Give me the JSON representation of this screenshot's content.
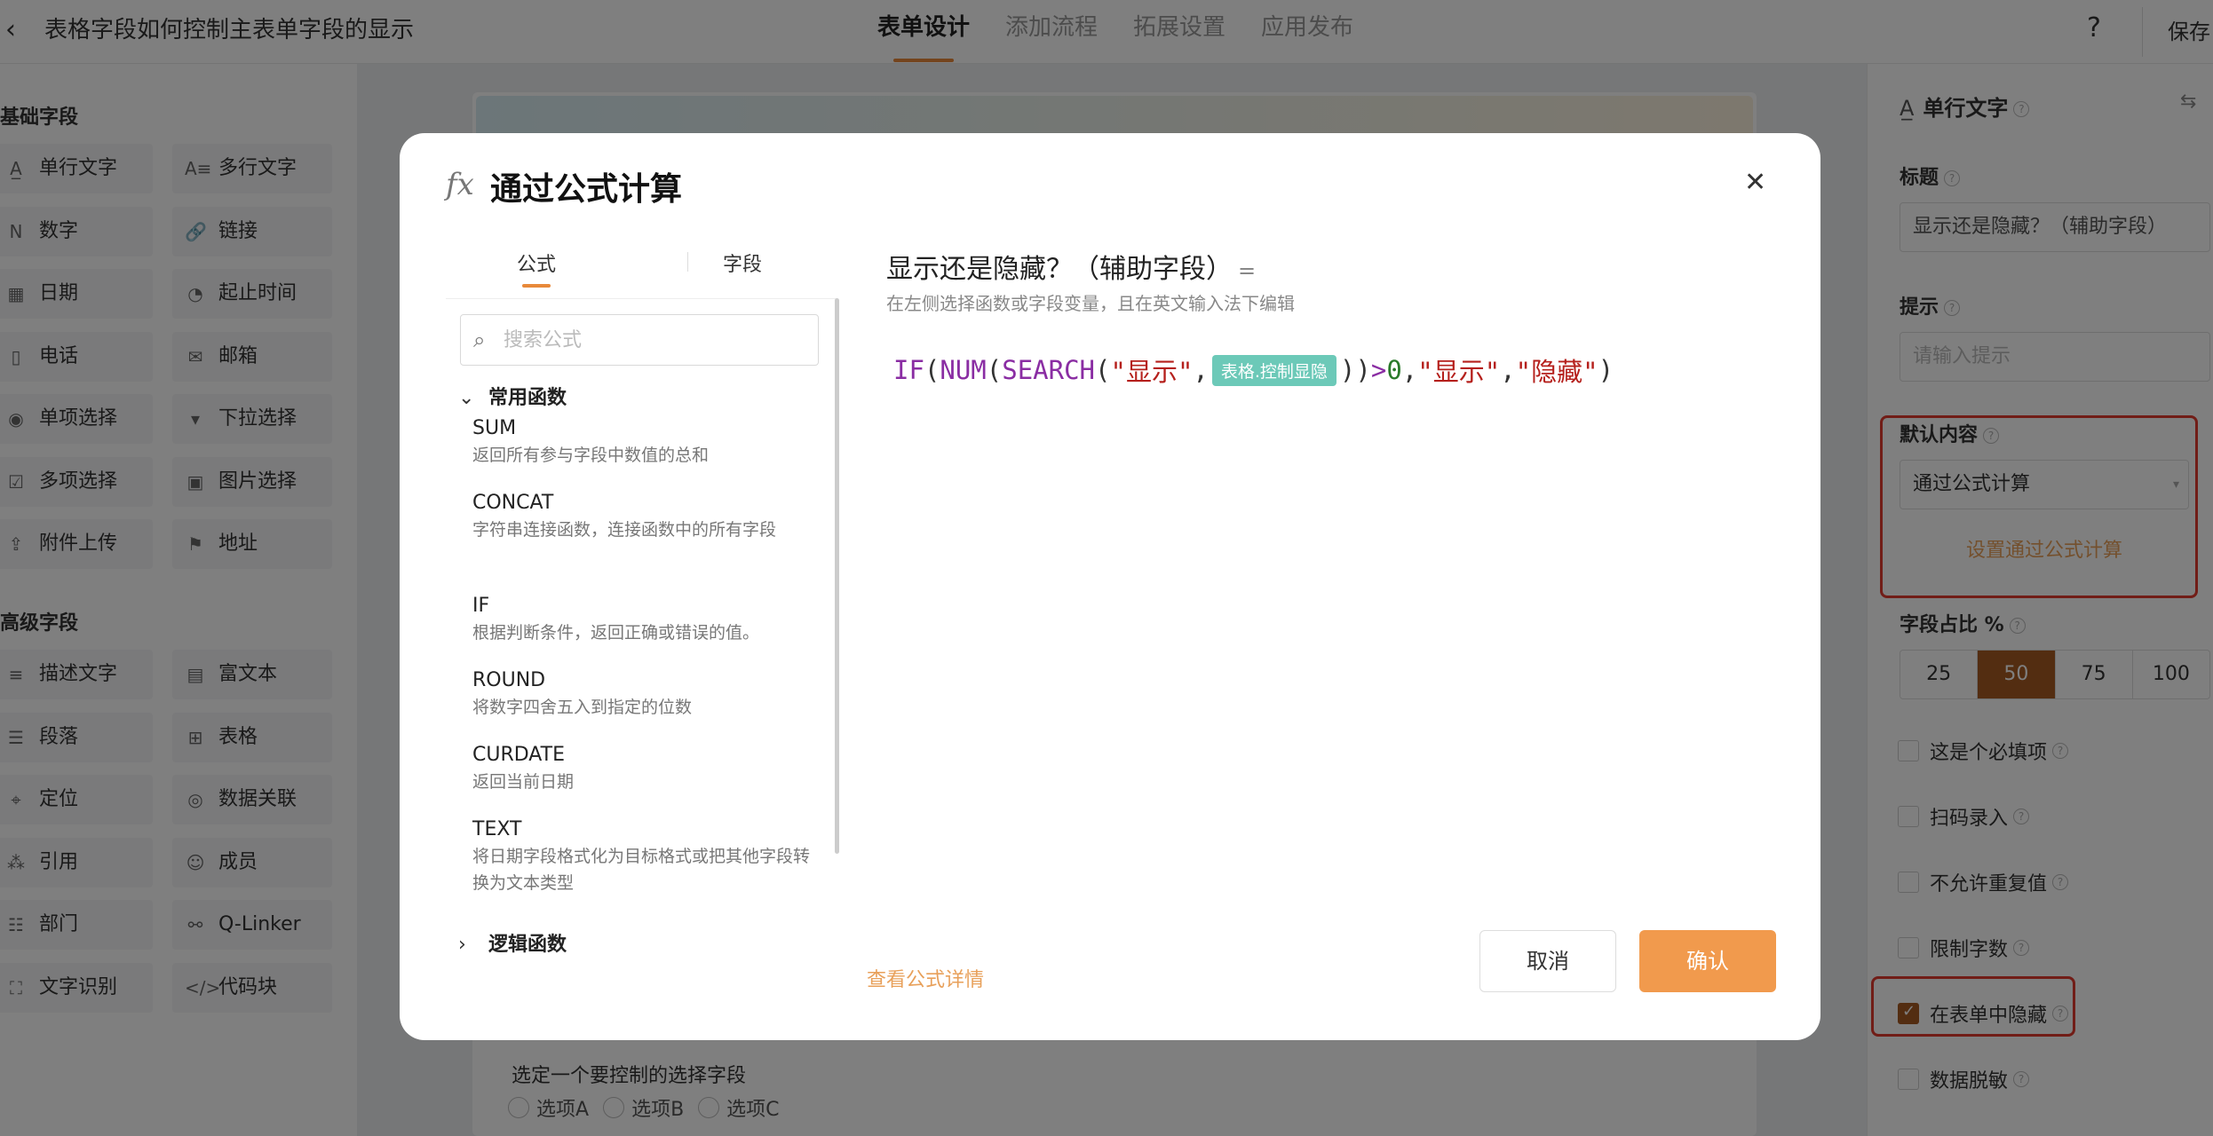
{
  "header": {
    "back_icon": "chevron-left-icon",
    "title": "表格字段如何控制主表单字段的显示",
    "tabs": [
      {
        "label": "表单设计",
        "active": true
      },
      {
        "label": "添加流程"
      },
      {
        "label": "拓展设置"
      },
      {
        "label": "应用发布"
      }
    ],
    "help_label": "?",
    "save_label": "保存"
  },
  "palette": {
    "basic_title": "基础字段",
    "basic_items": [
      {
        "label": "单行文字",
        "icon": "A̲"
      },
      {
        "label": "多行文字",
        "icon": "A≡"
      },
      {
        "label": "数字",
        "icon": "N"
      },
      {
        "label": "链接",
        "icon": "🔗"
      },
      {
        "label": "日期",
        "icon": "▦"
      },
      {
        "label": "起止时间",
        "icon": "◔"
      },
      {
        "label": "电话",
        "icon": "▯"
      },
      {
        "label": "邮箱",
        "icon": "✉"
      },
      {
        "label": "单项选择",
        "icon": "◉"
      },
      {
        "label": "下拉选择",
        "icon": "▾"
      },
      {
        "label": "多项选择",
        "icon": "☑"
      },
      {
        "label": "图片选择",
        "icon": "▣"
      },
      {
        "label": "附件上传",
        "icon": "⇪"
      },
      {
        "label": "地址",
        "icon": "⚑"
      }
    ],
    "advanced_title": "高级字段",
    "advanced_items": [
      {
        "label": "描述文字",
        "icon": "≡"
      },
      {
        "label": "富文本",
        "icon": "▤"
      },
      {
        "label": "段落",
        "icon": "☰"
      },
      {
        "label": "表格",
        "icon": "⊞"
      },
      {
        "label": "定位",
        "icon": "⌖"
      },
      {
        "label": "数据关联",
        "icon": "◎"
      },
      {
        "label": "引用",
        "icon": "⁂"
      },
      {
        "label": "成员",
        "icon": "☺"
      },
      {
        "label": "部门",
        "icon": "☷"
      },
      {
        "label": "Q-Linker",
        "icon": "⚯"
      },
      {
        "label": "文字识别",
        "icon": "⛶"
      },
      {
        "label": "代码块",
        "icon": "</>"
      }
    ]
  },
  "canvas": {
    "question": "选定一个要控制的选择字段",
    "options": [
      "选项A",
      "选项B",
      "选项C"
    ]
  },
  "right_panel": {
    "field_type": "单行文字",
    "title_label": "标题",
    "title_value": "显示还是隐藏？（辅助字段）",
    "hint_label": "提示",
    "hint_placeholder": "请输入提示",
    "default_label": "默认内容",
    "default_value": "通过公式计算",
    "default_link": "设置通过公式计算",
    "ratio_label": "字段占比 %",
    "ratios": [
      {
        "label": "25"
      },
      {
        "label": "50",
        "active": true
      },
      {
        "label": "75"
      },
      {
        "label": "100"
      }
    ],
    "checkboxes": [
      {
        "label": "这是个必填项",
        "checked": false
      },
      {
        "label": "扫码录入",
        "checked": false
      },
      {
        "label": "不允许重复值",
        "checked": false
      },
      {
        "label": "限制字数",
        "checked": false
      },
      {
        "label": "在表单中隐藏",
        "checked": true
      },
      {
        "label": "数据脱敏",
        "checked": false
      }
    ],
    "highlight_color": "#e33b2e",
    "accent_color": "#a65a22"
  },
  "modal": {
    "fx_icon": "fx",
    "title": "通过公式计算",
    "close_icon": "close-icon",
    "tabs": [
      {
        "label": "公式",
        "active": true
      },
      {
        "label": "字段"
      }
    ],
    "search_placeholder": "搜索公式",
    "groups": [
      {
        "label": "常用函数",
        "expanded": true
      },
      {
        "label": "逻辑函数",
        "expanded": false
      }
    ],
    "functions": [
      {
        "name": "SUM",
        "desc": "返回所有参与字段中数值的总和"
      },
      {
        "name": "CONCAT",
        "desc": "字符串连接函数，连接函数中的所有字段"
      },
      {
        "name": "IF",
        "desc": "根据判断条件，返回正确或错误的值。"
      },
      {
        "name": "ROUND",
        "desc": "将数字四舍五入到指定的位数"
      },
      {
        "name": "CURDATE",
        "desc": "返回当前日期"
      },
      {
        "name": "TEXT",
        "desc": "将日期字段格式化为目标格式或把其他字段转换为文本类型"
      }
    ],
    "formula_title": "显示还是隐藏？（辅助字段）",
    "formula_eq": "=",
    "formula_hint": "在左侧选择函数或字段变量，且在英文输入法下编辑",
    "formula": {
      "if": "IF",
      "num": "NUM",
      "search": "SEARCH",
      "lparen": "(",
      "rparen": ")",
      "comma": ",",
      "str_show": "\"显示\"",
      "field": "表格.控制显隐",
      "gt": ">",
      "zero": "0",
      "str_hide": "\"隐藏\""
    },
    "detail_link": "查看公式详情",
    "cancel_label": "取消",
    "confirm_label": "确认",
    "accent_color": "#f19a4d"
  }
}
